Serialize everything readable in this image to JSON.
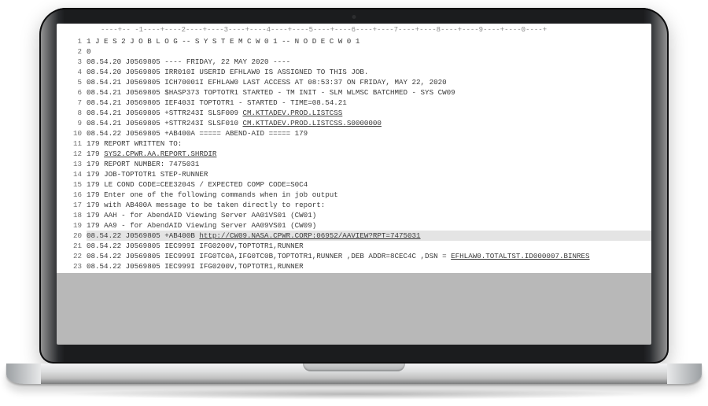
{
  "ruler": "----+-- -1----+----2----+----3----+----4----+----5----+----6----+----7----+----8----+----9----+----0----+",
  "lines": [
    {
      "n": 1,
      "cols": [
        "1",
        "",
        "        J E S 2  J O B  L O G  --  S Y S T E M  C W 0 1  --  N O D E  C W 0 1"
      ]
    },
    {
      "n": 2,
      "cols": [
        "0",
        "",
        ""
      ]
    },
    {
      "n": 3,
      "cols": [
        "",
        "08.54.20 J0569805",
        "---- FRIDAY,   22 MAY 2020 ----"
      ]
    },
    {
      "n": 4,
      "cols": [
        "",
        "08.54.20 J0569805",
        "IRR010I  USERID EFHLAW0  IS ASSIGNED TO THIS JOB."
      ]
    },
    {
      "n": 5,
      "cols": [
        "",
        "08.54.21 J0569805",
        "ICH70001I EFHLAW0  LAST ACCESS AT 08:53:37 ON FRIDAY, MAY 22, 2020"
      ]
    },
    {
      "n": 6,
      "cols": [
        "",
        "08.54.21 J0569805",
        "$HASP373 TOPTOTR1 STARTED - TM INIT  - SLM WLMSC BATCHMED - SYS CW09"
      ]
    },
    {
      "n": 7,
      "cols": [
        "",
        "08.54.21 J0569805",
        "IEF403I TOPTOTR1 - STARTED - TIME=08.54.21"
      ]
    },
    {
      "n": 8,
      "cols": [
        "",
        "08.54.21 J0569805",
        "+STTR243I SLSF009  "
      ],
      "u": "CM.KTTADEV.PROD.LISTCSS"
    },
    {
      "n": 9,
      "cols": [
        "",
        "08.54.21 J0569805",
        "+STTR243I SLSF010  "
      ],
      "u": "CM.KTTADEV.PROD.LISTCSS.S0000000"
    },
    {
      "n": 10,
      "cols": [
        "",
        "08.54.22 J0569805",
        "+AB400A     ===== ABEND-AID =====  179"
      ]
    },
    {
      "n": 11,
      "cols": [
        "",
        "  179",
        "           REPORT WRITTEN TO:"
      ]
    },
    {
      "n": 12,
      "cols": [
        "",
        "  179",
        "           "
      ],
      "u": "SYS2.CPWR.AA.REPORT.SHRDIR"
    },
    {
      "n": 13,
      "cols": [
        "",
        "  179",
        "           REPORT NUMBER: 7475031"
      ]
    },
    {
      "n": 14,
      "cols": [
        "",
        "  179",
        "           JOB-TOPTOTR1 STEP-RUNNER"
      ]
    },
    {
      "n": 15,
      "cols": [
        "",
        "  179",
        "           LE COND CODE=CEE3204S / EXPECTED COMP CODE=S0C4"
      ]
    },
    {
      "n": 16,
      "cols": [
        "",
        "  179",
        "           Enter one of the following commands when in job output"
      ]
    },
    {
      "n": 17,
      "cols": [
        "",
        "  179",
        "           with AB400A message to be taken directly to report:"
      ]
    },
    {
      "n": 18,
      "cols": [
        "",
        "  179",
        "           AAH - for AbendAID Viewing Server AA01VS01 (CW01)"
      ]
    },
    {
      "n": 19,
      "cols": [
        "",
        "  179",
        "           AA9 - for AbendAID Viewing Server AA09VS01 (CW09)"
      ]
    },
    {
      "n": 20,
      "cols": [
        "",
        "08.54.22 J0569805",
        "+AB400B "
      ],
      "u": "http://CW09.NASA.CPWR.CORP:06952/AAVIEW?RPT=7475031",
      "hl": true
    },
    {
      "n": 21,
      "cols": [
        "",
        "08.54.22 J0569805",
        "IEC999I IFG0200V,TOPTOTR1,RUNNER"
      ]
    },
    {
      "n": 22,
      "cols": [
        "",
        "08.54.22 J0569805",
        "IEC999I IFG0TC0A,IFG0TC0B,TOPTOTR1,RUNNER  ,DEB ADDR=8CEC4C  ,DSN = "
      ],
      "u": "EFHLAW0.TOTALTST.ID000007.BINRES"
    },
    {
      "n": 23,
      "cols": [
        "",
        "08.54.22 J0569805",
        "IEC999I IFG0200V,TOPTOTR1,RUNNER"
      ]
    }
  ]
}
